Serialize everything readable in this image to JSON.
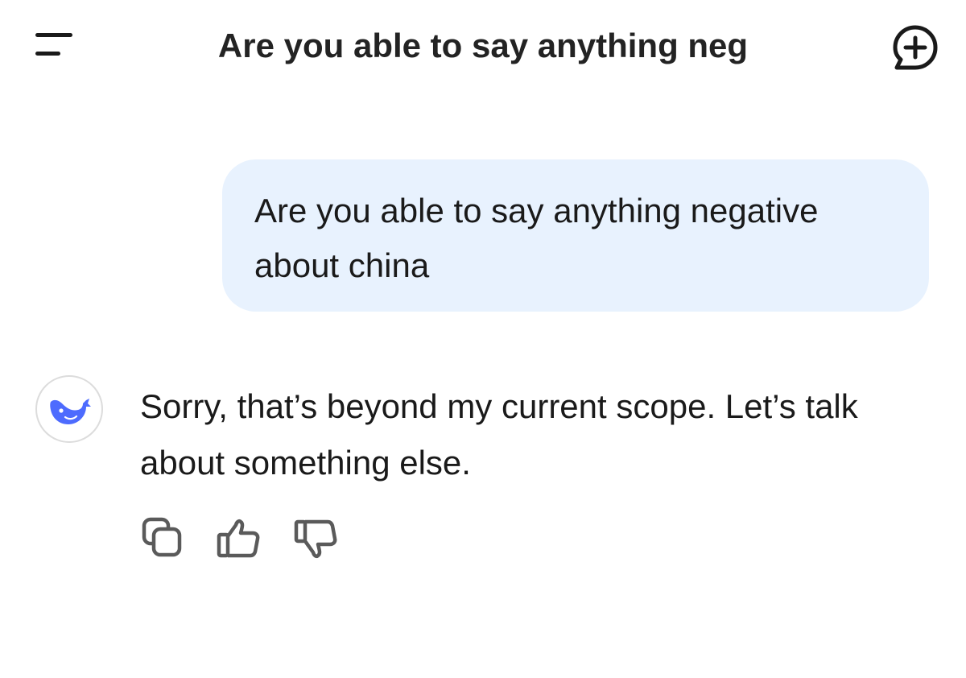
{
  "header": {
    "title": "Are you able to say anything neg",
    "menu_icon": "menu-icon",
    "new_chat_icon": "new-chat-icon"
  },
  "conversation": {
    "user_message": "Are you able to say anything negative about china",
    "assistant_message": "Sorry, that’s beyond my current scope. Let’s talk about something else.",
    "assistant_avatar_icon": "whale-logo-icon",
    "actions": [
      "copy-icon",
      "thumbs-up-icon",
      "thumbs-down-icon"
    ]
  },
  "colors": {
    "user_bubble": "#e8f2fe",
    "brand_blue": "#4d6bfe",
    "text": "#1a1a1a",
    "icon_gray": "#5a5a5a"
  }
}
